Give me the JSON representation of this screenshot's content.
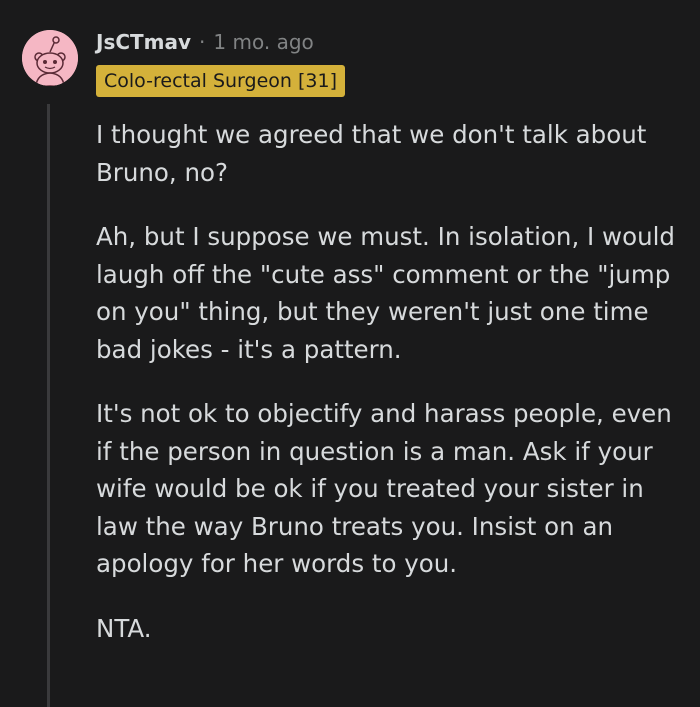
{
  "comment": {
    "username": "JsCTmav",
    "separator": "·",
    "timestamp": "1 mo. ago",
    "flair": "Colo-rectal Surgeon [31]",
    "avatar_icon": "snoo-avatar-icon",
    "flair_color": "#d4b13a",
    "paragraphs": [
      "I thought we agreed that we don't talk about Bruno, no?",
      "Ah, but I suppose we must. In isolation, I would laugh off the \"cute ass\" comment or the \"jump on you\" thing, but they weren't just one time bad jokes - it's a pattern.",
      "It's not ok to objectify and harass people, even if the person in question is a man. Ask if your wife would be ok if you treated your sister in law the way Bruno treats you. Insist on an apology for her words to you.",
      "NTA."
    ]
  }
}
